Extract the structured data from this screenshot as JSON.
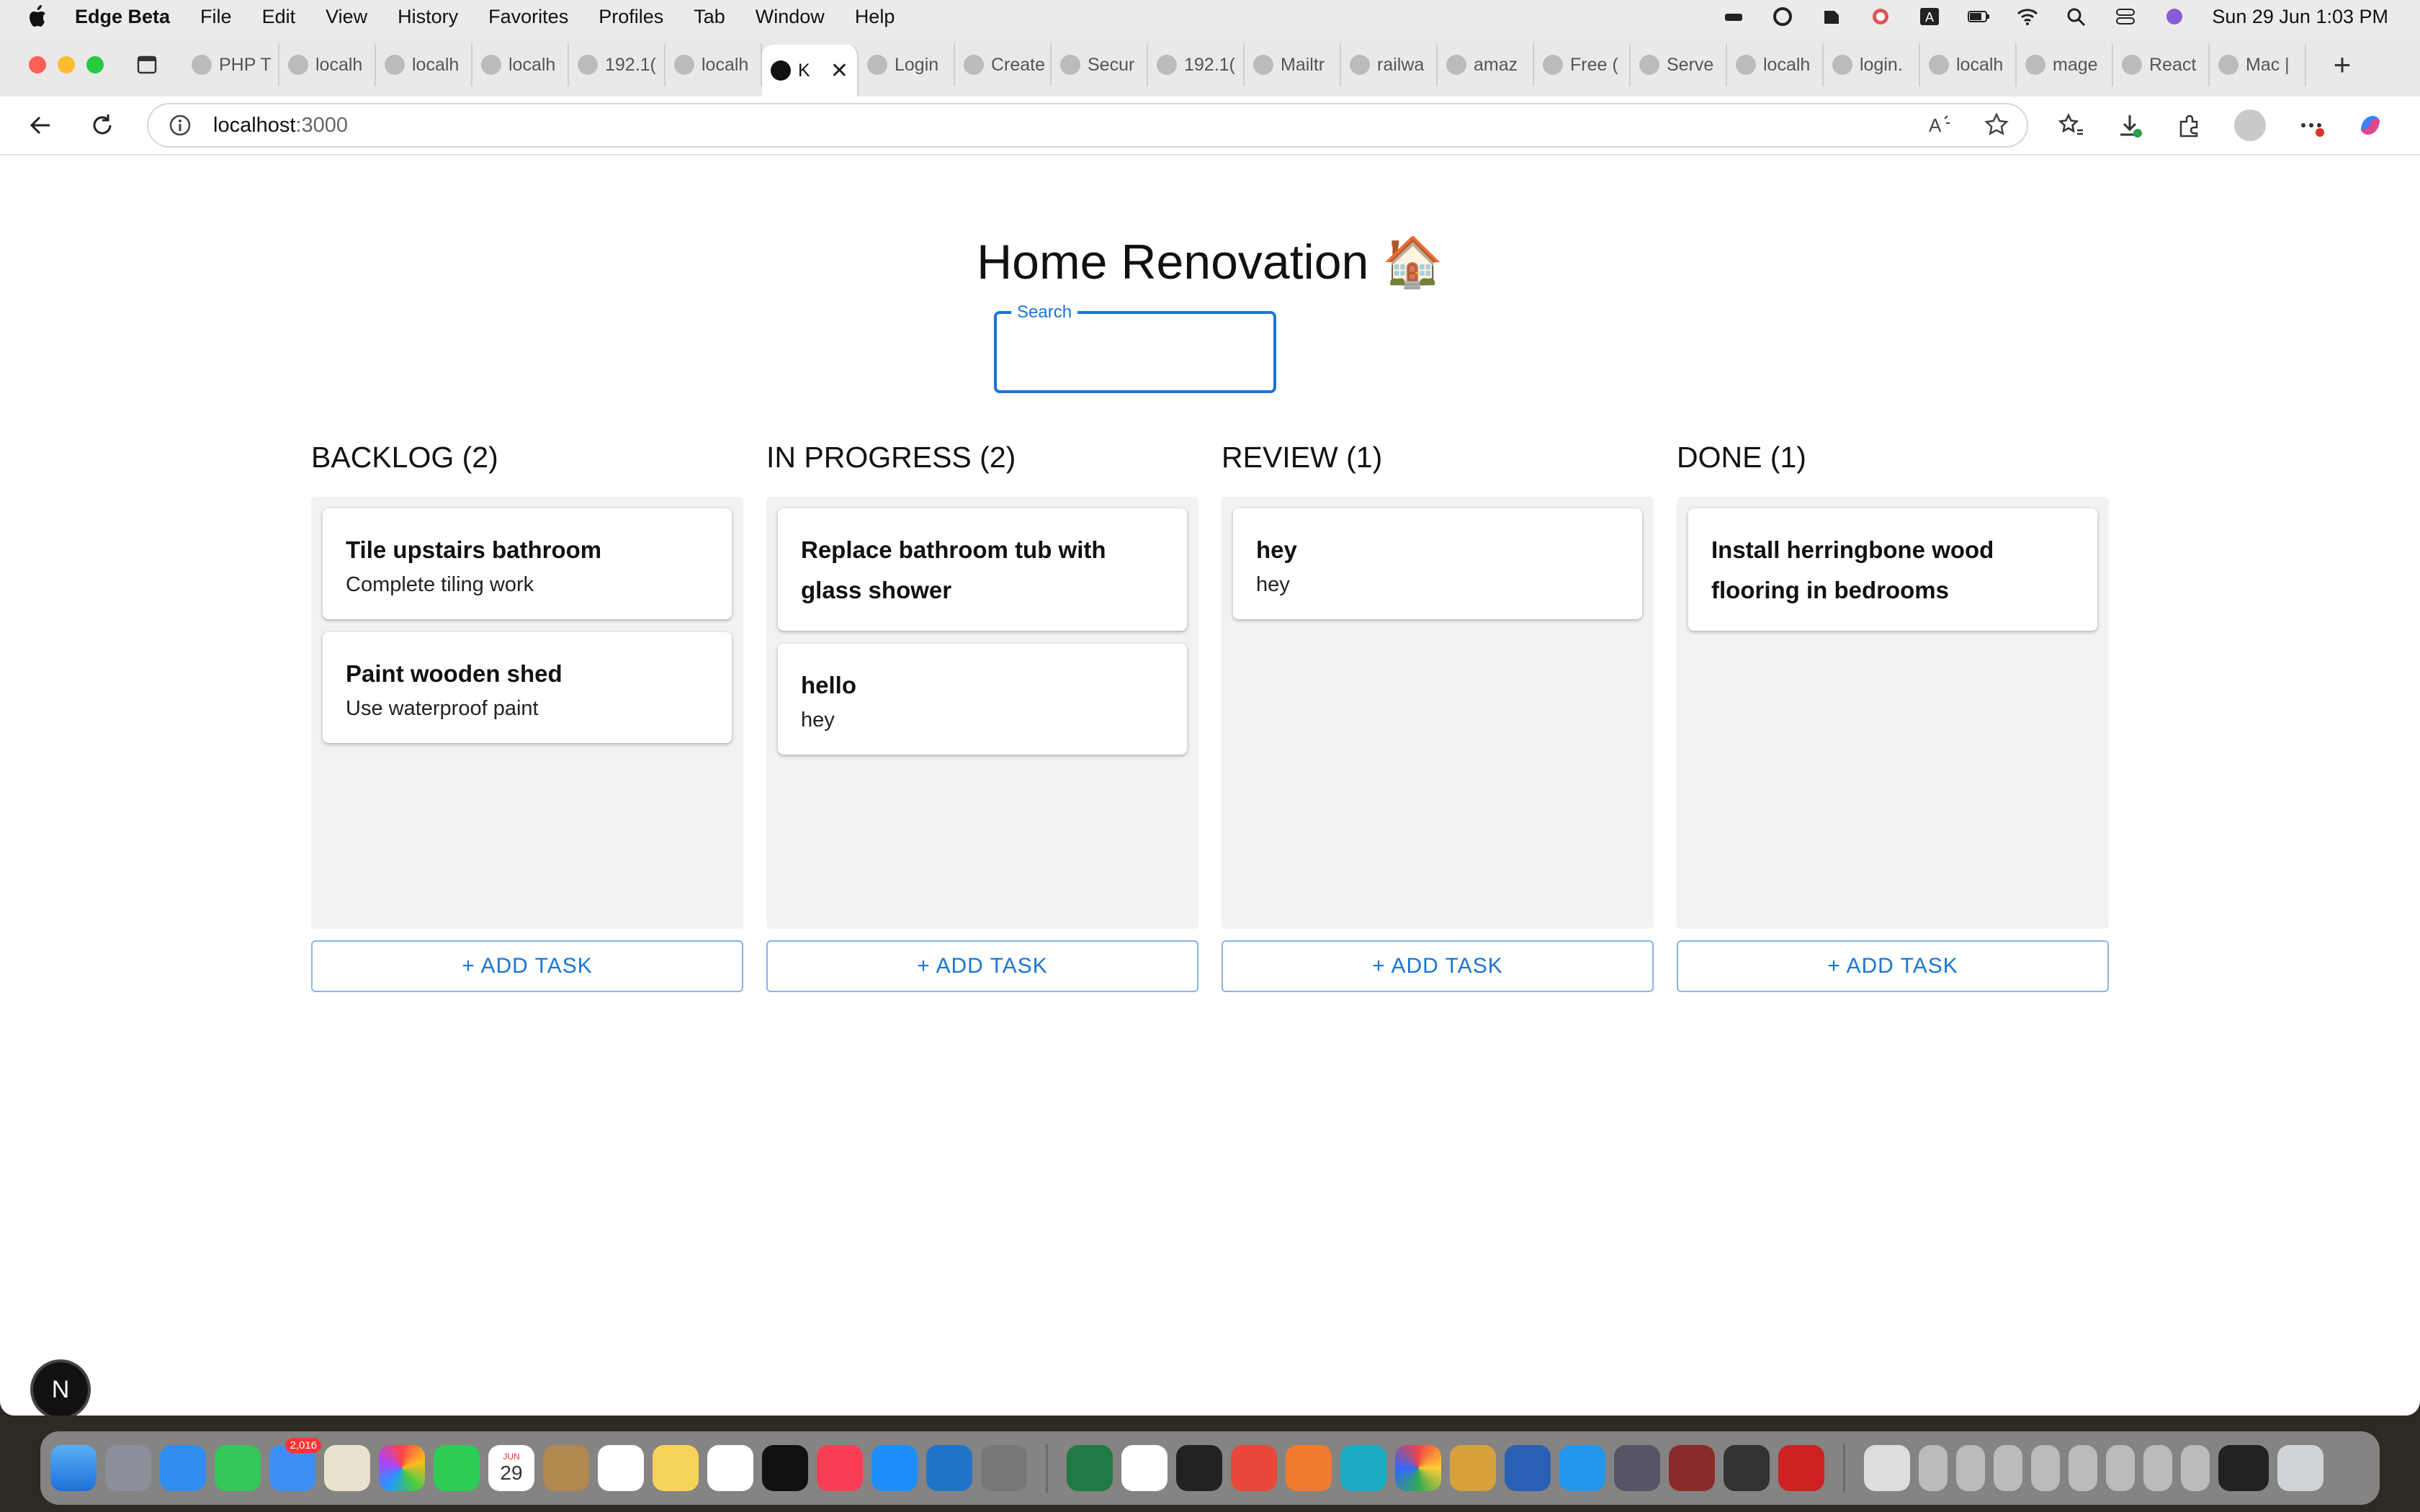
{
  "menubar": {
    "app_name": "Edge Beta",
    "items": [
      "File",
      "Edit",
      "View",
      "History",
      "Favorites",
      "Profiles",
      "Tab",
      "Window",
      "Help"
    ],
    "clock": "Sun 29 Jun  1:03 PM"
  },
  "tabs": [
    {
      "label": "PHP T"
    },
    {
      "label": "localh"
    },
    {
      "label": "localh"
    },
    {
      "label": "localh"
    },
    {
      "label": "192.1("
    },
    {
      "label": "localh"
    },
    {
      "label": "K",
      "active": true
    },
    {
      "label": "Login"
    },
    {
      "label": "Create"
    },
    {
      "label": "Secur"
    },
    {
      "label": "192.1("
    },
    {
      "label": "Mailtr"
    },
    {
      "label": "railwa"
    },
    {
      "label": "amaz"
    },
    {
      "label": "Free ("
    },
    {
      "label": "Serve"
    },
    {
      "label": "localh"
    },
    {
      "label": "login."
    },
    {
      "label": "localh"
    },
    {
      "label": "mage"
    },
    {
      "label": "React"
    },
    {
      "label": "Mac |"
    }
  ],
  "address_bar": {
    "host": "localhost",
    "port": ":3000"
  },
  "board": {
    "title": "Home Renovation 🏠",
    "search": {
      "label": "Search",
      "value": ""
    },
    "columns": [
      {
        "header": "BACKLOG (2)",
        "add_label": "+ ADD TASK",
        "cards": [
          {
            "title": "Tile upstairs bathroom",
            "desc": "Complete tiling work"
          },
          {
            "title": "Paint wooden shed",
            "desc": "Use waterproof paint"
          }
        ]
      },
      {
        "header": "IN PROGRESS (2)",
        "add_label": "+ ADD TASK",
        "cards": [
          {
            "title": "Replace bathroom tub with glass shower",
            "desc": ""
          },
          {
            "title": "hello",
            "desc": "hey"
          }
        ]
      },
      {
        "header": "REVIEW (1)",
        "add_label": "+ ADD TASK",
        "cards": [
          {
            "title": "hey",
            "desc": "hey"
          }
        ]
      },
      {
        "header": "DONE (1)",
        "add_label": "+ ADD TASK",
        "cards": [
          {
            "title": "Install herringbone wood flooring in bedrooms",
            "desc": ""
          }
        ]
      }
    ]
  },
  "dev_badge": "N",
  "dock": {
    "mail_badge": "2,016",
    "calendar_month": "JUN",
    "calendar_day": "29"
  },
  "colors": {
    "accent": "#1976d2",
    "column_bg": "#f2f2f2"
  }
}
